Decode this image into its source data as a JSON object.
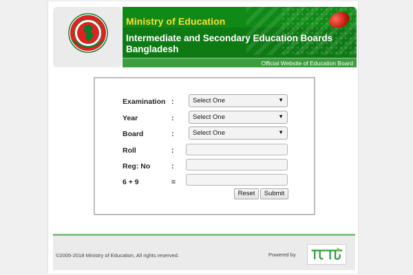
{
  "header": {
    "ministry": "Ministry of Education",
    "board_title": "Intermediate and Secondary Education Boards Bangladesh",
    "official": "Official Website of Education Board"
  },
  "form": {
    "examination": {
      "label": "Examination",
      "colon": ":",
      "value": "Select One"
    },
    "year": {
      "label": "Year",
      "colon": ":",
      "value": "Select One"
    },
    "board": {
      "label": "Board",
      "colon": ":",
      "value": "Select One"
    },
    "roll": {
      "label": "Roll",
      "colon": ":",
      "value": ""
    },
    "reg": {
      "label": "Reg: No",
      "colon": ":",
      "value": ""
    },
    "captcha": {
      "label": "6 + 9",
      "colon": "=",
      "value": ""
    },
    "reset_label": "Reset",
    "submit_label": "Submit"
  },
  "footer": {
    "copyright": "©2005-2018 Ministry of Education, All rights reserved.",
    "powered": "Powered by"
  },
  "icons": {
    "seal": "government-seal-icon",
    "teletalk": "teletalk-logo",
    "dropdown": "chevron-down-icon"
  },
  "colors": {
    "banner_green": "#0e7a14",
    "ministry_yellow": "#ffdd33",
    "footer_rule": "#7ec27e"
  }
}
